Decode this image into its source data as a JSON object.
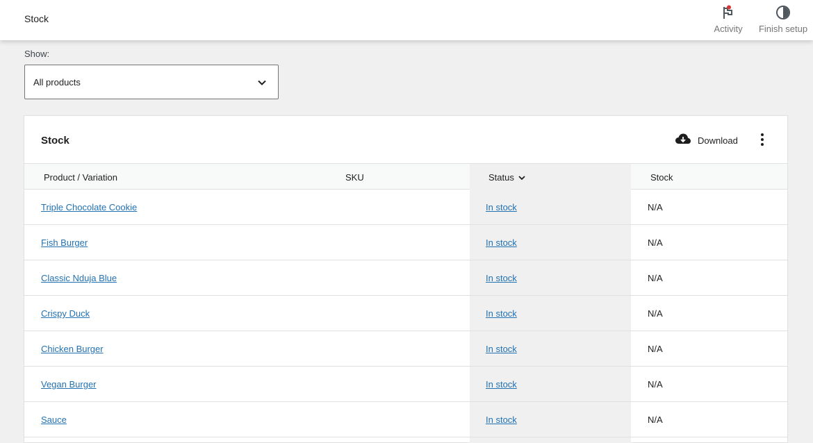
{
  "header": {
    "title": "Stock",
    "actions": [
      {
        "label": "Activity",
        "icon": "flag-icon"
      },
      {
        "label": "Finish setup",
        "icon": "half-circle-icon"
      }
    ],
    "activity_badge_color": "#d63638"
  },
  "filter": {
    "label": "Show:",
    "selected": "All products"
  },
  "card": {
    "title": "Stock",
    "download_label": "Download",
    "columns": [
      "Product / Variation",
      "SKU",
      "Status",
      "Stock"
    ],
    "rows": [
      {
        "product": "Triple Chocolate Cookie",
        "sku": "",
        "status": "In stock",
        "stock": "N/A"
      },
      {
        "product": "Fish Burger",
        "sku": "",
        "status": "In stock",
        "stock": "N/A"
      },
      {
        "product": "Classic Nduja Blue",
        "sku": "",
        "status": "In stock",
        "stock": "N/A"
      },
      {
        "product": "Crispy Duck",
        "sku": "",
        "status": "In stock",
        "stock": "N/A"
      },
      {
        "product": "Chicken Burger",
        "sku": "",
        "status": "In stock",
        "stock": "N/A"
      },
      {
        "product": "Vegan Burger",
        "sku": "",
        "status": "In stock",
        "stock": "N/A"
      },
      {
        "product": "Sauce",
        "sku": "",
        "status": "In stock",
        "stock": "N/A"
      }
    ]
  },
  "colors": {
    "link": "#2271b1",
    "background": "#f0f0f1"
  }
}
